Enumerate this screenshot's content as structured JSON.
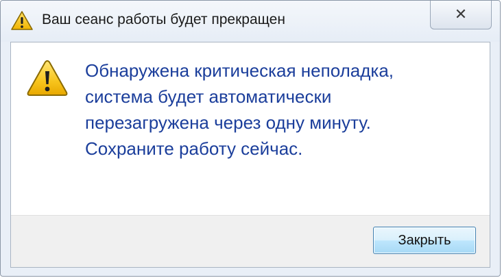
{
  "window": {
    "title": "Ваш сеанс работы будет прекращен",
    "close_glyph": "✕",
    "title_icon": "warning-icon"
  },
  "dialog": {
    "icon": "warning-icon",
    "message_lines": [
      "Обнаружена критическая неполадка,",
      "система будет автоматически",
      "перезагружена через одну минуту.",
      "Сохраните работу сейчас."
    ],
    "button_label": "Закрыть"
  },
  "colors": {
    "message_text": "#1b3e9b",
    "warning_fill": "#f5c21b",
    "warning_outline": "#7a5a00"
  }
}
